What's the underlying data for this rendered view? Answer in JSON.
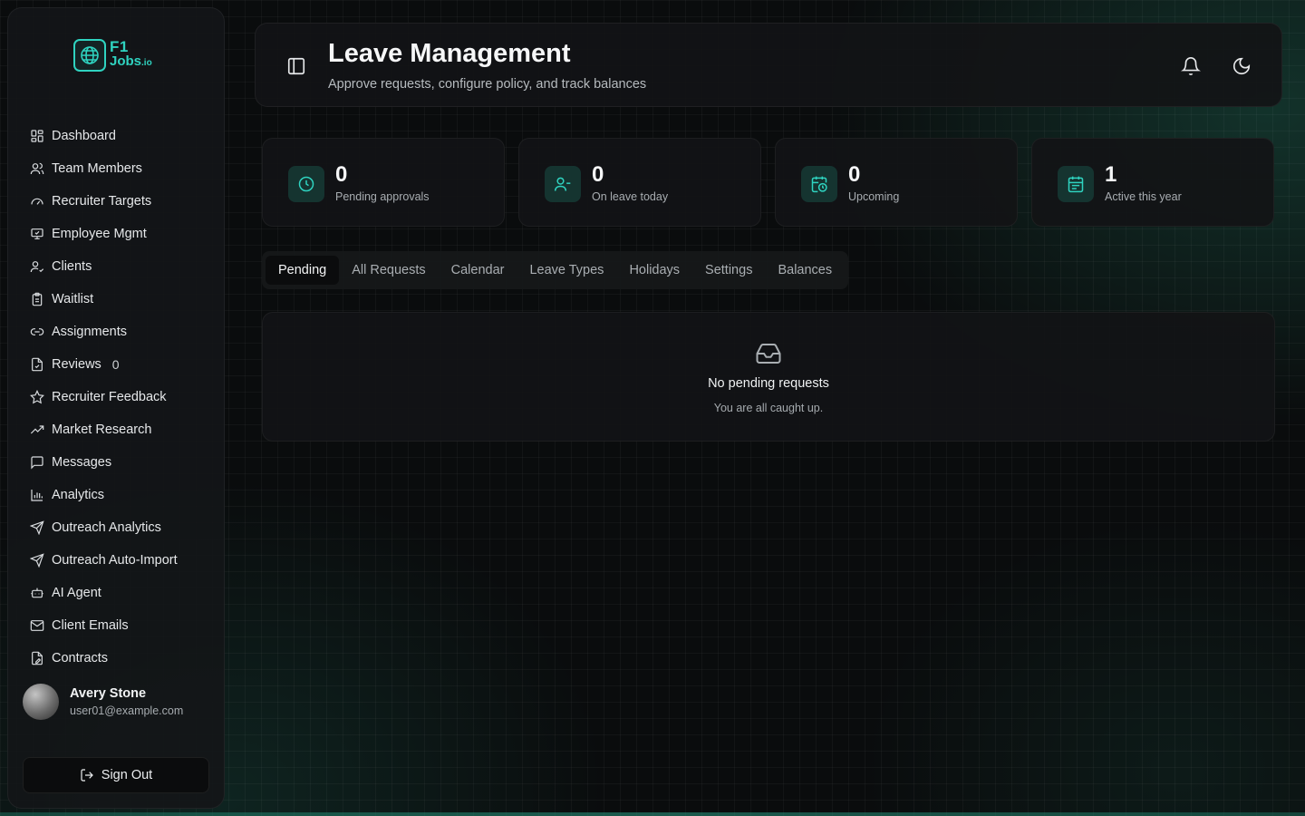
{
  "brand": {
    "line1": "F1",
    "line2": "Jobs",
    "suffix": ".io",
    "accent": "#2fd3c0"
  },
  "sidebar": {
    "items": [
      {
        "label": "Dashboard",
        "icon": "dashboard-icon"
      },
      {
        "label": "Team Members",
        "icon": "users-icon"
      },
      {
        "label": "Recruiter Targets",
        "icon": "gauge-icon"
      },
      {
        "label": "Employee Mgmt",
        "icon": "monitor-icon"
      },
      {
        "label": "Clients",
        "icon": "user-check-icon"
      },
      {
        "label": "Waitlist",
        "icon": "clipboard-icon"
      },
      {
        "label": "Assignments",
        "icon": "link-icon"
      },
      {
        "label": "Reviews",
        "icon": "file-check-icon",
        "badge": "0"
      },
      {
        "label": "Recruiter Feedback",
        "icon": "star-icon"
      },
      {
        "label": "Market Research",
        "icon": "trending-up-icon"
      },
      {
        "label": "Messages",
        "icon": "message-icon"
      },
      {
        "label": "Analytics",
        "icon": "bar-chart-icon"
      },
      {
        "label": "Outreach Analytics",
        "icon": "send-icon"
      },
      {
        "label": "Outreach Auto-Import",
        "icon": "send-icon"
      },
      {
        "label": "AI Agent",
        "icon": "bot-icon"
      },
      {
        "label": "Client Emails",
        "icon": "mail-icon"
      },
      {
        "label": "Contracts",
        "icon": "file-edit-icon"
      }
    ],
    "user": {
      "name": "Avery Stone",
      "email": "user01@example.com"
    },
    "signout_label": "Sign Out"
  },
  "header": {
    "title": "Leave Management",
    "subtitle": "Approve requests, configure policy, and track balances"
  },
  "stats": [
    {
      "value": "0",
      "label": "Pending approvals",
      "icon": "clock-icon"
    },
    {
      "value": "0",
      "label": "On leave today",
      "icon": "user-minus-icon"
    },
    {
      "value": "0",
      "label": "Upcoming",
      "icon": "calendar-clock-icon"
    },
    {
      "value": "1",
      "label": "Active this year",
      "icon": "calendar-icon"
    }
  ],
  "tabs": [
    {
      "label": "Pending",
      "active": true
    },
    {
      "label": "All Requests"
    },
    {
      "label": "Calendar"
    },
    {
      "label": "Leave Types"
    },
    {
      "label": "Holidays"
    },
    {
      "label": "Settings"
    },
    {
      "label": "Balances"
    }
  ],
  "empty_state": {
    "title": "No pending requests",
    "subtitle": "You are all caught up.",
    "icon": "inbox-icon"
  }
}
